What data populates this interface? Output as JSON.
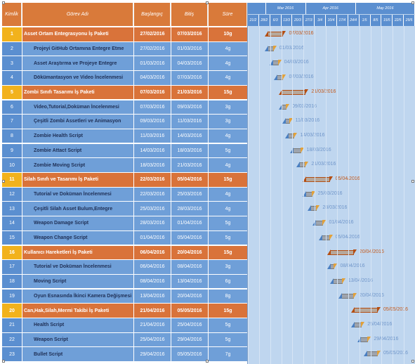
{
  "header": {
    "id": "Kimlik",
    "name": "Görev Adı",
    "start": "Başlangıç",
    "end": "Bitiş",
    "duration": "Süre"
  },
  "timeline": {
    "months": [
      "Mar 2016",
      "Apr 2016",
      "May 2016"
    ],
    "weeks": [
      "21/2",
      "28/2",
      "6/3",
      "13/3",
      "20/3",
      "27/3",
      "3/4",
      "10/4",
      "17/4",
      "24/4",
      "1/5",
      "8/5",
      "15/5",
      "22/5",
      "29/5"
    ]
  },
  "colors": {
    "summary_row": "#d9733a",
    "summary_id": "#f2b21c",
    "task_row": "#6f9fd8",
    "timeline_bg": "#bfd6ef"
  },
  "rows": [
    {
      "id": "1",
      "name": "Asset Ortam Entegrasyonu İş Paketi",
      "start": "27/02/2016",
      "end": "07/03/2016",
      "dur": "10g",
      "type": "summary"
    },
    {
      "id": "2",
      "name": "Projeyi GitHub Ortamına Entegre Etme",
      "start": "27/02/2016",
      "end": "01/03/2016",
      "dur": "4g",
      "type": "task"
    },
    {
      "id": "3",
      "name": "Asset Araştırma ve Projeye Entegre",
      "start": "01/03/2016",
      "end": "04/03/2016",
      "dur": "4g",
      "type": "task"
    },
    {
      "id": "4",
      "name": "Dökümantasyon ve Video İncelenmesi",
      "start": "04/03/2016",
      "end": "07/03/2016",
      "dur": "4g",
      "type": "task"
    },
    {
      "id": "5",
      "name": "Zombi Sınıfı Tasarımı İş Paketi",
      "start": "07/03/2016",
      "end": "21/03/2016",
      "dur": "15g",
      "type": "summary"
    },
    {
      "id": "6",
      "name": "Video,Tutorial,Doküman İncelenmesi",
      "start": "07/03/2016",
      "end": "09/03/2016",
      "dur": "3g",
      "type": "task"
    },
    {
      "id": "7",
      "name": "Çeşitli Zombi Assetleri ve Animasyon",
      "start": "09/03/2016",
      "end": "11/03/2016",
      "dur": "3g",
      "type": "task"
    },
    {
      "id": "8",
      "name": "Zombie Health Script",
      "start": "11/03/2016",
      "end": "14/03/2016",
      "dur": "4g",
      "type": "task"
    },
    {
      "id": "9",
      "name": "Zombie Attact Script",
      "start": "14/03/2016",
      "end": "18/03/2016",
      "dur": "5g",
      "type": "task"
    },
    {
      "id": "10",
      "name": "Zombie Moving Script",
      "start": "18/03/2016",
      "end": "21/03/2016",
      "dur": "4g",
      "type": "task"
    },
    {
      "id": "11",
      "name": "Silah Sınıfı ve Tasarımı İş Paketi",
      "start": "22/03/2016",
      "end": "05/04/2016",
      "dur": "15g",
      "type": "summary"
    },
    {
      "id": "12",
      "name": "Tutorial ve Doküman İncelenmesi",
      "start": "22/03/2016",
      "end": "25/03/2016",
      "dur": "4g",
      "type": "task"
    },
    {
      "id": "13",
      "name": "Çeşitli Silah Asset Bulum,Entegre",
      "start": "25/03/2016",
      "end": "28/03/2016",
      "dur": "4g",
      "type": "task"
    },
    {
      "id": "14",
      "name": "Weapon Damage Script",
      "start": "28/03/2016",
      "end": "01/04/2016",
      "dur": "5g",
      "type": "task"
    },
    {
      "id": "15",
      "name": "Weapon Change Script",
      "start": "01/04/2016",
      "end": "05/04/2016",
      "dur": "5g",
      "type": "task"
    },
    {
      "id": "16",
      "name": "Kullanıcı Hareketleri İş Paketi",
      "start": "06/04/2016",
      "end": "20/04/2016",
      "dur": "15g",
      "type": "summary"
    },
    {
      "id": "17",
      "name": "Tutorial ve Doküman İncelenmesi",
      "start": "06/04/2016",
      "end": "08/04/2016",
      "dur": "3g",
      "type": "task"
    },
    {
      "id": "18",
      "name": "Moving Script",
      "start": "08/04/2016",
      "end": "13/04/2016",
      "dur": "6g",
      "type": "task"
    },
    {
      "id": "19",
      "name": "Oyun Esnasında İkinci Kamera Değişmesi",
      "start": "13/04/2016",
      "end": "20/04/2016",
      "dur": "8g",
      "type": "task"
    },
    {
      "id": "20",
      "name": "Can,Hak,Silah,Mermi Takibi İş Paketi",
      "start": "21/04/2016",
      "end": "05/05/2016",
      "dur": "15g",
      "type": "summary"
    },
    {
      "id": "21",
      "name": "Health Script",
      "start": "21/04/2016",
      "end": "25/04/2016",
      "dur": "5g",
      "type": "task"
    },
    {
      "id": "22",
      "name": "Weapon Script",
      "start": "25/04/2016",
      "end": "29/04/2016",
      "dur": "5g",
      "type": "task"
    },
    {
      "id": "23",
      "name": "Bullet Script",
      "start": "29/04/2016",
      "end": "05/05/2016",
      "dur": "7g",
      "type": "task"
    }
  ]
}
